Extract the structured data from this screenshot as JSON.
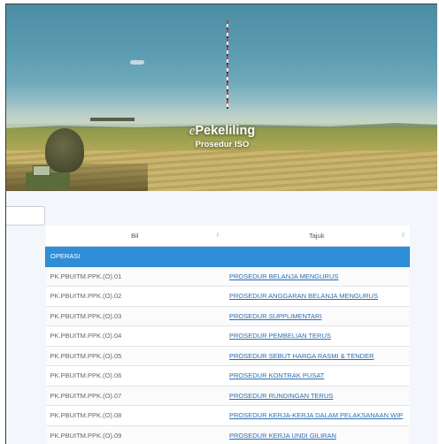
{
  "hero": {
    "title_prefix": "e",
    "title_main": "Pekeliling",
    "subtitle": "Prosedur ISO"
  },
  "search": {
    "value": ""
  },
  "table": {
    "headers": {
      "bil": "Bil",
      "tajuk": "Tajuk"
    },
    "group": "OPERASI",
    "rows": [
      {
        "code": "PK.PBUITM.PPK.(O).01",
        "title": "PROSEDUR BELANJA MENGURUS"
      },
      {
        "code": "PK.PBUITM.PPK.(O).02",
        "title": "PROSEDUR ANGGARAN BELANJA MENGURUS"
      },
      {
        "code": "PK.PBUITM.PPK.(O).03",
        "title": "PROSEDUR SUPPLIMENTARI"
      },
      {
        "code": "PK.PBUITM.PPK.(O).04",
        "title": "PROSEDUR PEMBELIAN TERUS"
      },
      {
        "code": "PK.PBUITM.PPK.(O).05",
        "title": "PROSEDUR SEBUT HARGA RASMI & TENDER"
      },
      {
        "code": "PK.PBUITM.PPK.(O).06",
        "title": "PROSEDUR KONTRAK PUSAT"
      },
      {
        "code": "PK.PBUITM.PPK.(O).07",
        "title": "PROSEDUR RUNDINGAN TERUS"
      },
      {
        "code": "PK.PBUITM.PPK.(O).08",
        "title": "PROSEDUR KERJA-KERJA DALAM PELAKSANAAN WIP"
      },
      {
        "code": "PK.PBUITM.PPK.(O).09",
        "title": "PROSEDUR KERJA UNDI GILIRAN"
      }
    ]
  },
  "colors": {
    "group_header": "#2f8ed8",
    "link": "#2b6fb4"
  }
}
